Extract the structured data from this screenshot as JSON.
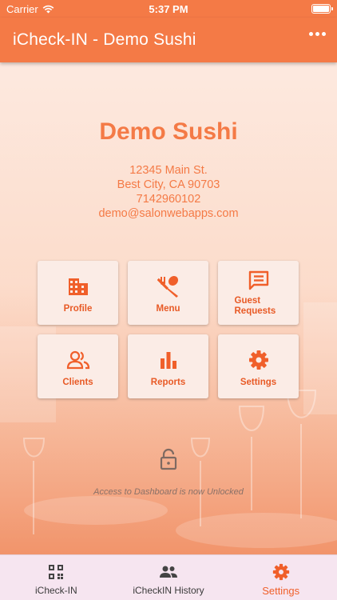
{
  "status_bar": {
    "carrier": "Carrier",
    "time": "5:37 PM"
  },
  "nav": {
    "title": "iCheck-IN - Demo Sushi",
    "more_icon": "more-horizontal-icon"
  },
  "business": {
    "name": "Demo Sushi",
    "address": "12345 Main St.",
    "city_line": "Best City, CA 90703",
    "phone": "7142960102",
    "email": "demo@salonwebapps.com"
  },
  "tiles": [
    {
      "label": "Profile",
      "icon": "building-icon"
    },
    {
      "label": "Menu",
      "icon": "utensils-icon"
    },
    {
      "label": "Guest Requests",
      "icon": "message-icon"
    },
    {
      "label": "Clients",
      "icon": "people-icon"
    },
    {
      "label": "Reports",
      "icon": "bar-chart-icon"
    },
    {
      "label": "Settings",
      "icon": "gear-icon"
    }
  ],
  "lock": {
    "icon": "unlock-icon",
    "message": "Access to Dashboard is now Unlocked"
  },
  "tabs": [
    {
      "label": "iCheck-IN",
      "icon": "qr-code-icon",
      "active": false
    },
    {
      "label": "iCheckIN History",
      "icon": "people-icon",
      "active": false
    },
    {
      "label": "Settings",
      "icon": "gear-icon",
      "active": true
    }
  ],
  "colors": {
    "primary": "#f47a46",
    "accent": "#f05f2a",
    "tab_bar": "#f6e5f0"
  }
}
